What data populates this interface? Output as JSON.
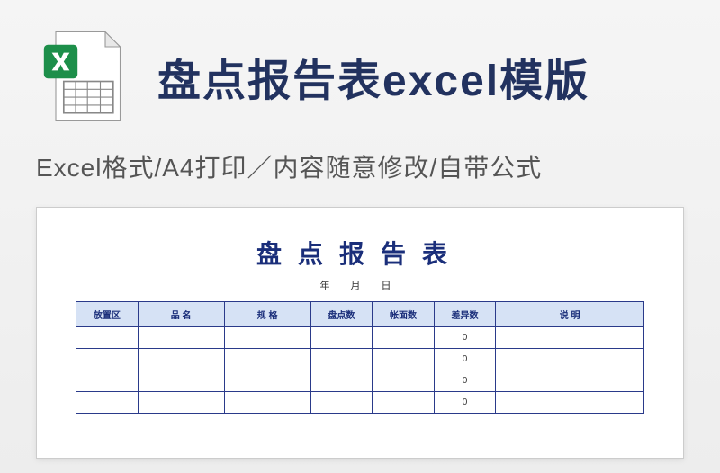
{
  "header": {
    "title": "盘点报告表excel模版",
    "subtitle": "Excel格式/A4打印／内容随意修改/自带公式"
  },
  "icon": {
    "name": "excel-file-icon"
  },
  "preview": {
    "doc_title": "盘点报告表",
    "doc_date": "年 月 日",
    "columns": [
      "放置区",
      "品 名",
      "规 格",
      "盘点数",
      "帐面数",
      "差异数",
      "说 明"
    ],
    "rows": [
      {
        "c0": "",
        "c1": "",
        "c2": "",
        "c3": "",
        "c4": "",
        "c5": "0",
        "c6": ""
      },
      {
        "c0": "",
        "c1": "",
        "c2": "",
        "c3": "",
        "c4": "",
        "c5": "0",
        "c6": ""
      },
      {
        "c0": "",
        "c1": "",
        "c2": "",
        "c3": "",
        "c4": "",
        "c5": "0",
        "c6": ""
      },
      {
        "c0": "",
        "c1": "",
        "c2": "",
        "c3": "",
        "c4": "",
        "c5": "0",
        "c6": ""
      }
    ]
  }
}
